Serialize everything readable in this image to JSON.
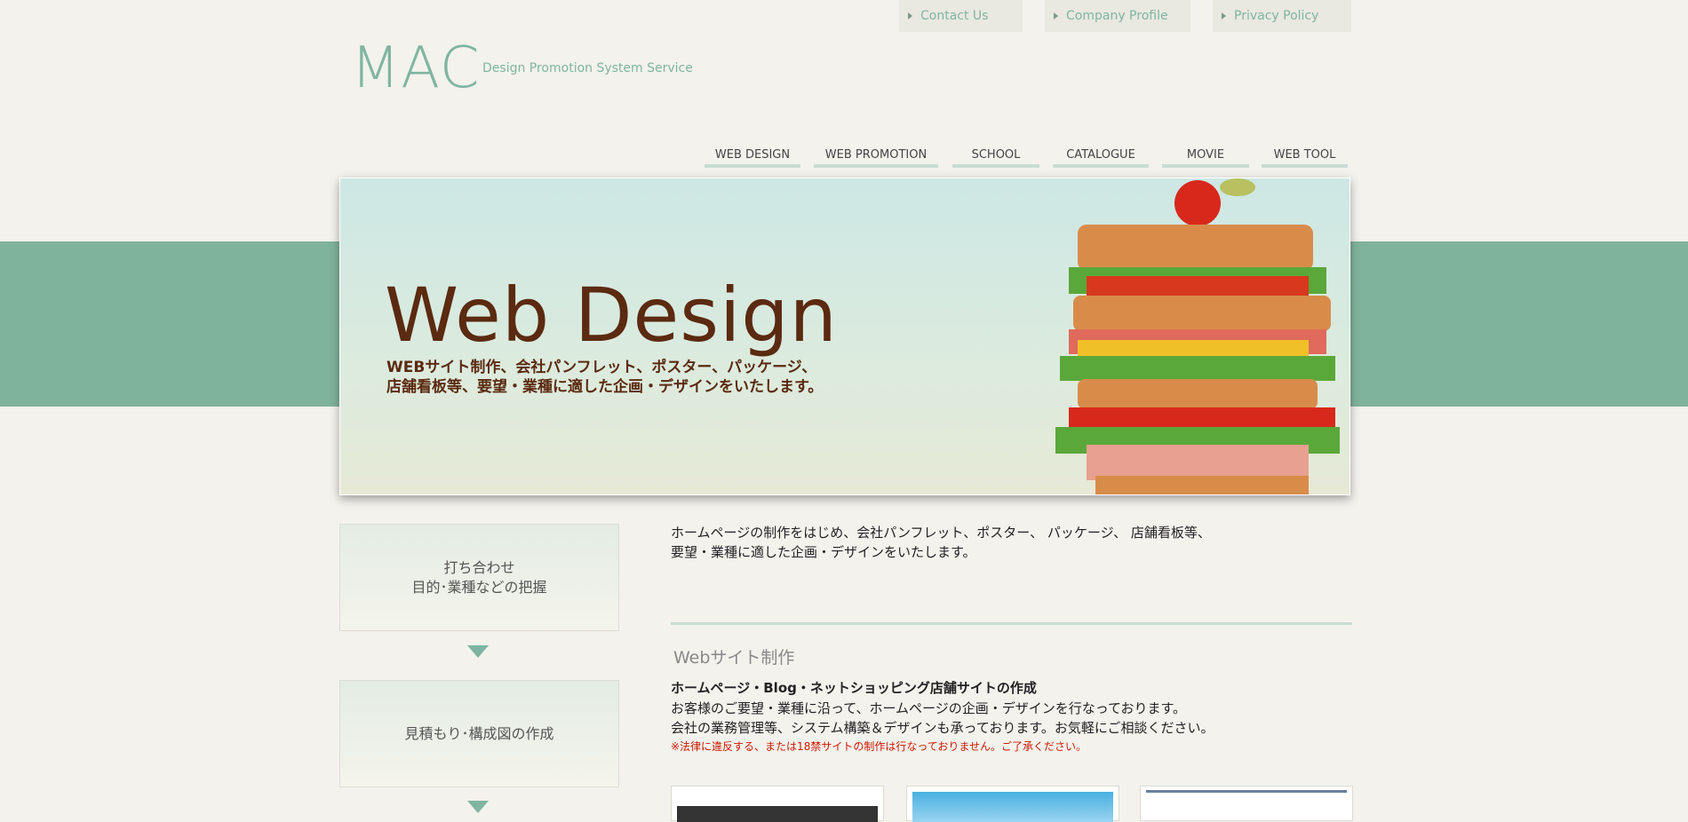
{
  "top_links": [
    {
      "label": "Contact Us"
    },
    {
      "label": "Company Profile"
    },
    {
      "label": "Privacy Policy"
    }
  ],
  "logo": {
    "text": "MAC",
    "tagline": "Design Promotion System Service"
  },
  "nav": [
    {
      "label": "WEB DESIGN"
    },
    {
      "label": "WEB PROMOTION"
    },
    {
      "label": "SCHOOL"
    },
    {
      "label": "CATALOGUE"
    },
    {
      "label": "MOVIE"
    },
    {
      "label": "WEB TOOL"
    }
  ],
  "banner": {
    "title": "Web Design",
    "line1": "WEBサイト制作、会社パンフレット、ポスター、パッケージ、",
    "line2": "店舗看板等、要望・業種に適した企画・デザインをいたします。"
  },
  "steps": [
    {
      "line1": "打ち合わせ",
      "line2": "目的･業種などの把握"
    },
    {
      "line1": "見積もり･構成図の作成",
      "line2": ""
    }
  ],
  "intro": {
    "line1": "ホームページの制作をはじめ、会社パンフレット、ポスター、 パッケージ、 店舗看板等、",
    "line2": "要望・業種に適した企画・デザインをいたします。"
  },
  "section": {
    "heading": "Webサイト制作",
    "bold": "ホームページ・Blog・ネットショッピング店舗サイトの作成",
    "line1": "お客様のご要望・業種に沿って、ホームページの企画・デザインを行なっております。",
    "line2": "会社の業務管理等、システム構築＆デザインも承っております。お気軽にご相談ください。",
    "notice": "※法律に違反する、または18禁サイトの制作は行なっておりません。ご了承ください。"
  },
  "colors": {
    "accent": "#7fb5a0",
    "band": "#80b39c",
    "title": "#5b2a10",
    "notice": "#cc1a00"
  }
}
